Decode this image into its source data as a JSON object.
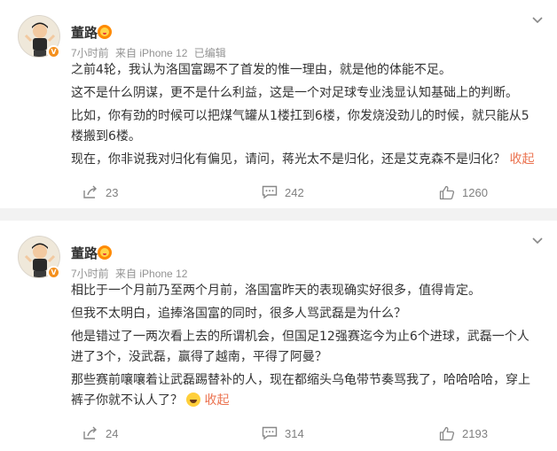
{
  "posts": [
    {
      "author": "董路",
      "meta": {
        "time": "7小时前",
        "source": "来自 iPhone 12",
        "edited": "已编辑"
      },
      "paragraphs": [
        "之前4轮，我认为洛国富踢不了首发的惟一理由，就是他的体能不足。",
        "这不是什么阴谋，更不是什么利益，这是一个对足球专业浅显认知基础上的判断。",
        "比如，你有劲的时候可以把煤气罐从1楼扛到6楼，你发烧没劲儿的时候，就只能从5楼搬到6楼。",
        "现在，你非说我对归化有偏见，请问，蒋光太不是归化，还是艾克森不是归化？"
      ],
      "collapse_label": "收起",
      "shares": "23",
      "comments": "242",
      "likes": "1260"
    },
    {
      "author": "董路",
      "meta": {
        "time": "7小时前",
        "source": "来自 iPhone 12"
      },
      "paragraphs": [
        "相比于一个月前乃至两个月前，洛国富昨天的表现确实好很多，值得肯定。",
        "但我不太明白，追捧洛国富的同时，很多人骂武磊是为什么？",
        "他是错过了一两次看上去的所谓机会，但国足12强赛迄今为止6个进球，武磊一个人进了3个，没武磊，赢得了越南，平得了阿曼？",
        "那些赛前嚷嚷着让武磊踢替补的人，现在都缩头乌龟带节奏骂我了，哈哈哈哈，穿上裤子你就不认人了？"
      ],
      "emoji": "smile-emoji",
      "collapse_label": "收起",
      "shares": "24",
      "comments": "314",
      "likes": "2193"
    }
  ],
  "colors": {
    "link": "#eb7350",
    "text": "#333333",
    "meta": "#939393",
    "separator": "#f2f2f2",
    "verified": "#f4901e"
  }
}
